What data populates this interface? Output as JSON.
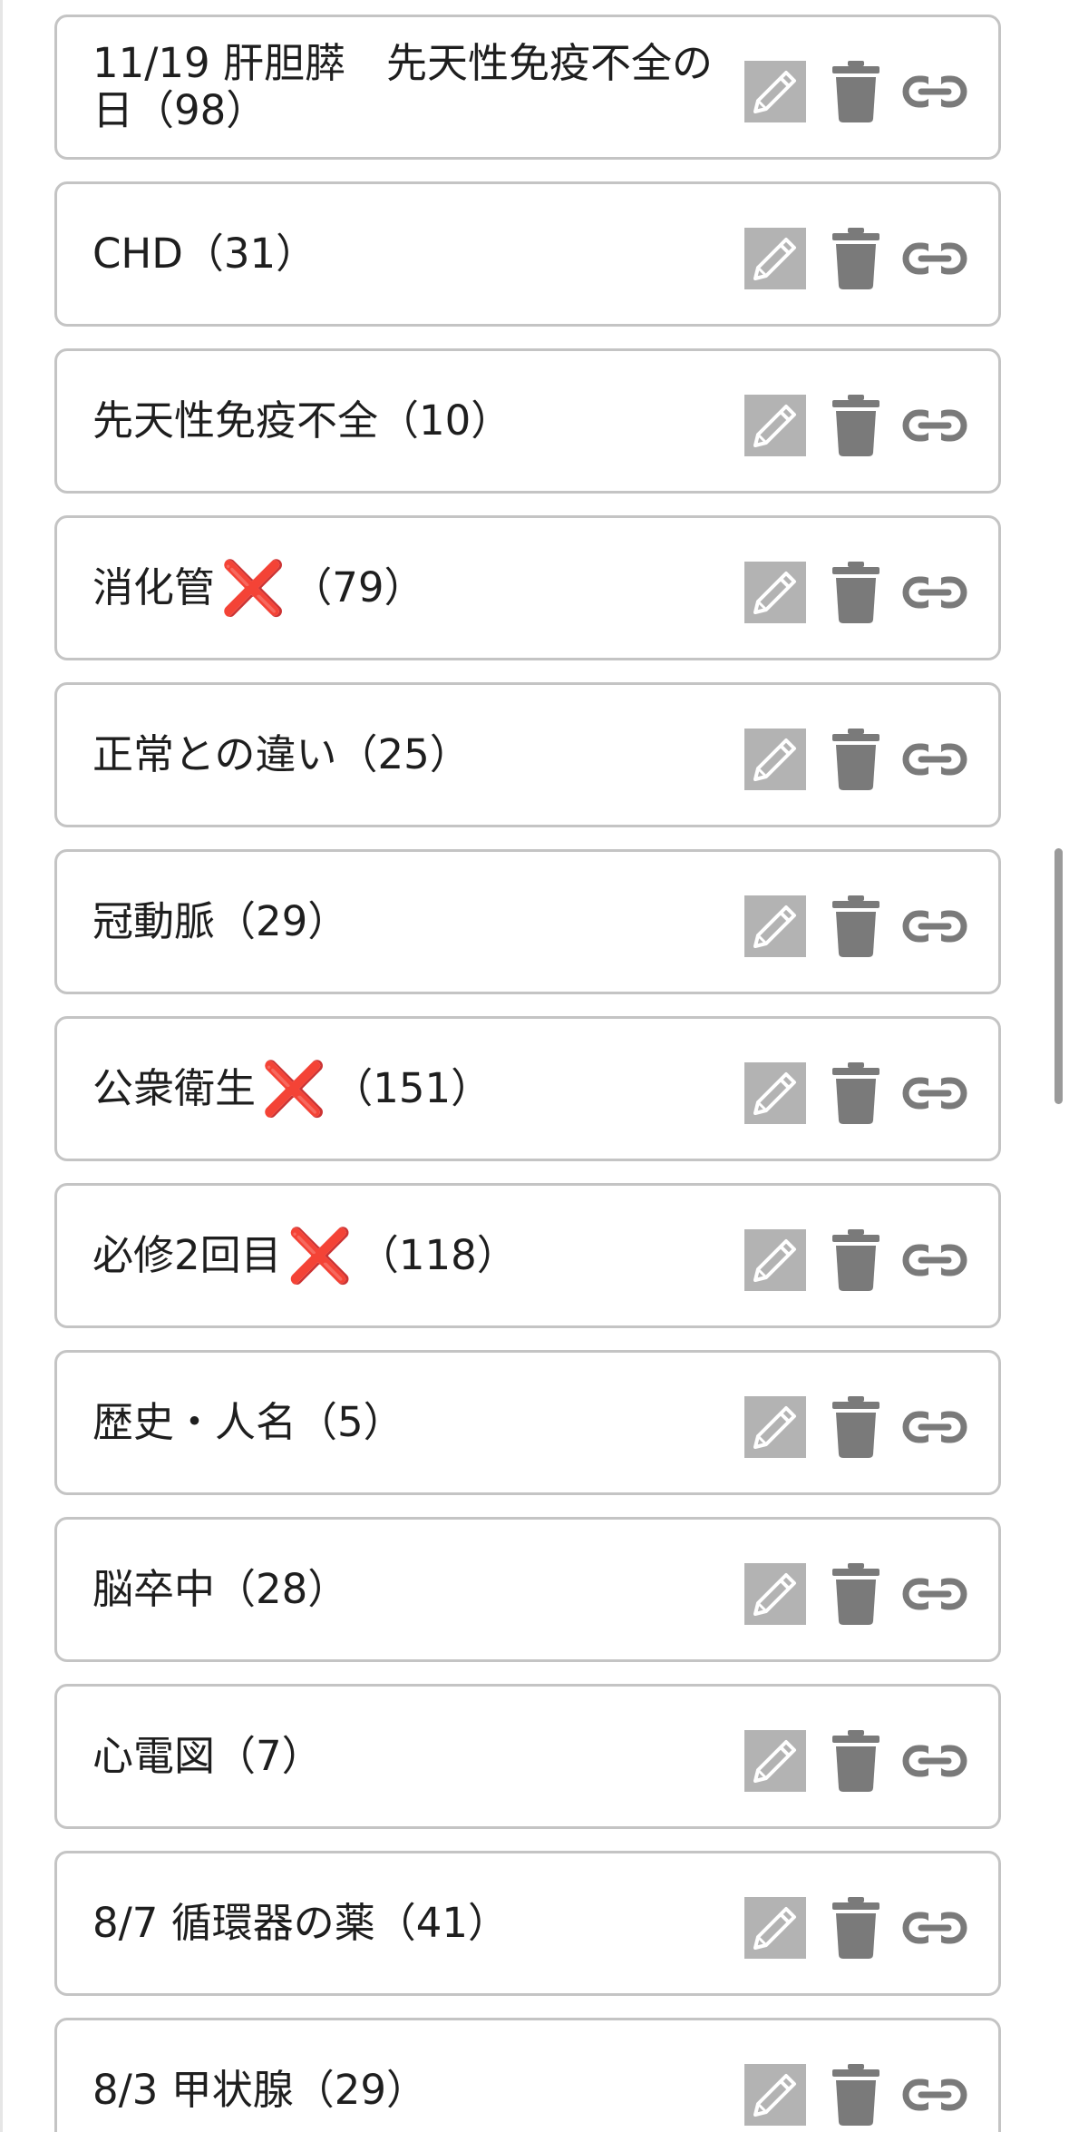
{
  "decks": [
    {
      "name": "11/19 肝胆膵　先天性免疫不全の日（98）",
      "line1": "11/19 肝胆膵　先天性免疫不全の",
      "line2": "日（98）"
    },
    {
      "name": "CHD（31）"
    },
    {
      "name": "先天性免疫不全（10）"
    },
    {
      "name_before": "消化管",
      "mark": "❌",
      "name_after": "（79）"
    },
    {
      "name": "正常との違い（25）"
    },
    {
      "name": "冠動脈（29）"
    },
    {
      "name_before": "公衆衛生",
      "mark": "❌",
      "name_after": "（151）"
    },
    {
      "name_before": "必修2回目",
      "mark": "❌",
      "name_after": "（118）"
    },
    {
      "name": "歴史・人名（5）"
    },
    {
      "name": "脳卒中（28）"
    },
    {
      "name": "心電図（7）"
    },
    {
      "name": "8/7 循環器の薬（41）"
    },
    {
      "name": "8/3 甲状腺（29）"
    }
  ],
  "icons": {
    "edit": "pencil-icon",
    "delete": "trash-icon",
    "link": "link-icon"
  },
  "colors": {
    "edit_bg": "#b3b3b3",
    "icon": "#7a7a7a",
    "border": "#c4c4c4",
    "mark": "#d83a2e",
    "scrollbar": "#9a9a9a"
  },
  "scroll": {
    "position": 0.5
  }
}
